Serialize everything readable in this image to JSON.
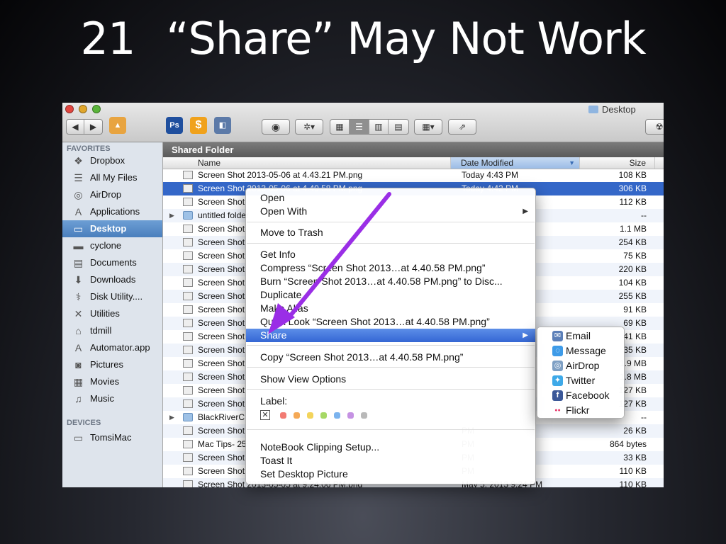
{
  "slide": {
    "number": "21",
    "title": "“Share” May Not Work"
  },
  "window": {
    "title": "Desktop",
    "path_title": "Shared Folder"
  },
  "colors": {
    "selection": "#3467c8",
    "menu_highlight": "#3567d4",
    "annotation_arrow": "#9a2ee6",
    "sidebar_bg": "#dee4ec"
  },
  "toolbar": {
    "nav": [
      "◀",
      "▶"
    ],
    "apps": [
      {
        "icon": "vlc-cone-icon",
        "label": ""
      },
      {
        "icon": "photoshop-icon",
        "label": "Ps"
      },
      {
        "icon": "dollar-app-icon",
        "label": "$"
      },
      {
        "icon": "preview-app-icon",
        "label": ""
      }
    ],
    "quicklook_icon": "eye-icon",
    "action_icon": "gear-icon",
    "view_icons": [
      "icon-view",
      "list-view",
      "column-view",
      "cover-flow-view"
    ],
    "arrange_icon": "arrange-icon",
    "share_icon": "share-icon"
  },
  "sidebar": {
    "favorites_header": "FAVORITES",
    "favorites": [
      {
        "label": "Dropbox",
        "icon": "dropbox-icon",
        "glyph": "❖"
      },
      {
        "label": "All My Files",
        "icon": "all-files-icon",
        "glyph": "☰"
      },
      {
        "label": "AirDrop",
        "icon": "airdrop-icon",
        "glyph": "◎"
      },
      {
        "label": "Applications",
        "icon": "applications-icon",
        "glyph": "A"
      },
      {
        "label": "Desktop",
        "icon": "desktop-icon",
        "glyph": "▭",
        "selected": true
      },
      {
        "label": "cyclone",
        "icon": "folder-icon",
        "glyph": "▬"
      },
      {
        "label": "Documents",
        "icon": "documents-icon",
        "glyph": "▤"
      },
      {
        "label": "Downloads",
        "icon": "downloads-icon",
        "glyph": "⬇"
      },
      {
        "label": "Disk Utility....",
        "icon": "disk-utility-icon",
        "glyph": "⚕"
      },
      {
        "label": "Utilities",
        "icon": "utilities-icon",
        "glyph": "✕"
      },
      {
        "label": "tdmill",
        "icon": "home-icon",
        "glyph": "⌂"
      },
      {
        "label": "Automator.app",
        "icon": "automator-icon",
        "glyph": "A"
      },
      {
        "label": "Pictures",
        "icon": "pictures-icon",
        "glyph": "◙"
      },
      {
        "label": "Movies",
        "icon": "movies-icon",
        "glyph": "▦"
      },
      {
        "label": "Music",
        "icon": "music-icon",
        "glyph": "♫"
      }
    ],
    "devices_header": "DEVICES",
    "devices": [
      {
        "label": "TomsiMac",
        "icon": "computer-icon",
        "glyph": "▭"
      }
    ]
  },
  "columns": {
    "name": "Name",
    "date": "Date Modified",
    "size": "Size"
  },
  "files": [
    {
      "name": "Screen Shot 2013-05-06 at 4.43.21 PM.png",
      "date": "Today 4:43 PM",
      "size": "108 KB"
    },
    {
      "name": "Screen Shot 2013-05-06 at 4.40.58 PM.png",
      "date": "Today 4:42 PM",
      "size": "306 KB",
      "selected": true
    },
    {
      "name": "Screen Shot",
      "date": "",
      "size": "112 KB"
    },
    {
      "name": "untitled folder",
      "date": "",
      "size": "--",
      "folder": true
    },
    {
      "name": "Screen Shot",
      "date": "",
      "size": "1.1 MB"
    },
    {
      "name": "Screen Shot",
      "date": "",
      "size": "254 KB"
    },
    {
      "name": "Screen Shot",
      "date": "",
      "size": "75 KB"
    },
    {
      "name": "Screen Shot",
      "date": "",
      "size": "220 KB"
    },
    {
      "name": "Screen Shot",
      "date": "",
      "size": "104 KB"
    },
    {
      "name": "Screen Shot",
      "date": "",
      "size": "255 KB"
    },
    {
      "name": "Screen Shot",
      "date": "",
      "size": "91 KB"
    },
    {
      "name": "Screen Shot",
      "date": "",
      "size": "69 KB"
    },
    {
      "name": "Screen Shot",
      "date": "",
      "size": "41 KB"
    },
    {
      "name": "Screen Shot",
      "date": "",
      "size": "35 KB"
    },
    {
      "name": "Screen Shot",
      "date": "",
      "size": "1.9 MB"
    },
    {
      "name": "Screen Shot",
      "date": "",
      "size": "1.8 MB"
    },
    {
      "name": "Screen Shot",
      "date": "",
      "size": "127 KB"
    },
    {
      "name": "Screen Shot",
      "date": "",
      "size": "127 KB"
    },
    {
      "name": "BlackRiverC",
      "date": "",
      "size": "--",
      "folder": true
    },
    {
      "name": "Screen Shot",
      "date": "PM",
      "size": "26 KB"
    },
    {
      "name": "Mac Tips- 25",
      "date": "PM",
      "size": "864 bytes"
    },
    {
      "name": "Screen Shot",
      "date": "PM",
      "size": "33 KB"
    },
    {
      "name": "Screen Shot",
      "date": "PM",
      "size": "110 KB"
    },
    {
      "name": "Screen Shot 2013-05-05 at 9.24.06 PM.png",
      "date": "May 5, 2013 9:24 PM",
      "size": "110 KB"
    }
  ],
  "context_menu": {
    "open": "Open",
    "open_with": "Open With",
    "move_to_trash": "Move to Trash",
    "get_info": "Get Info",
    "compress": "Compress “Screen Shot 2013…at 4.40.58 PM.png”",
    "burn": "Burn “Screen Shot 2013…at 4.40.58 PM.png” to Disc...",
    "duplicate": "Duplicate",
    "make_alias": "Make Alias",
    "quick_look": "Quick Look “Screen Shot 2013…at 4.40.58 PM.png”",
    "share": "Share",
    "copy": "Copy “Screen Shot 2013…at 4.40.58 PM.png”",
    "show_view_options": "Show View Options",
    "label": "Label:",
    "label_none": "✕",
    "label_colors": [
      "#f27b73",
      "#f5a956",
      "#f3d45b",
      "#a6d866",
      "#7bb3ee",
      "#c592e3",
      "#b9b9b9"
    ],
    "notebook": "NoteBook Clipping Setup...",
    "toast_it": "Toast It",
    "set_desktop_picture": "Set Desktop Picture",
    "submenu_arrow": "▶"
  },
  "share_menu": [
    {
      "label": "Email",
      "icon": "email-icon",
      "color": "#5b7fb8",
      "glyph": "✉"
    },
    {
      "label": "Message",
      "icon": "message-icon",
      "color": "#3e9be8",
      "glyph": "◌"
    },
    {
      "label": "AirDrop",
      "icon": "airdrop-icon",
      "color": "#7fa0c4",
      "glyph": "◎"
    },
    {
      "label": "Twitter",
      "icon": "twitter-icon",
      "color": "#3ea9e8",
      "glyph": "✦"
    },
    {
      "label": "Facebook",
      "icon": "facebook-icon",
      "color": "#3b5898",
      "glyph": "f"
    },
    {
      "label": "Flickr",
      "icon": "flickr-icon",
      "color": "#ffffff",
      "glyph": "●●"
    }
  ]
}
